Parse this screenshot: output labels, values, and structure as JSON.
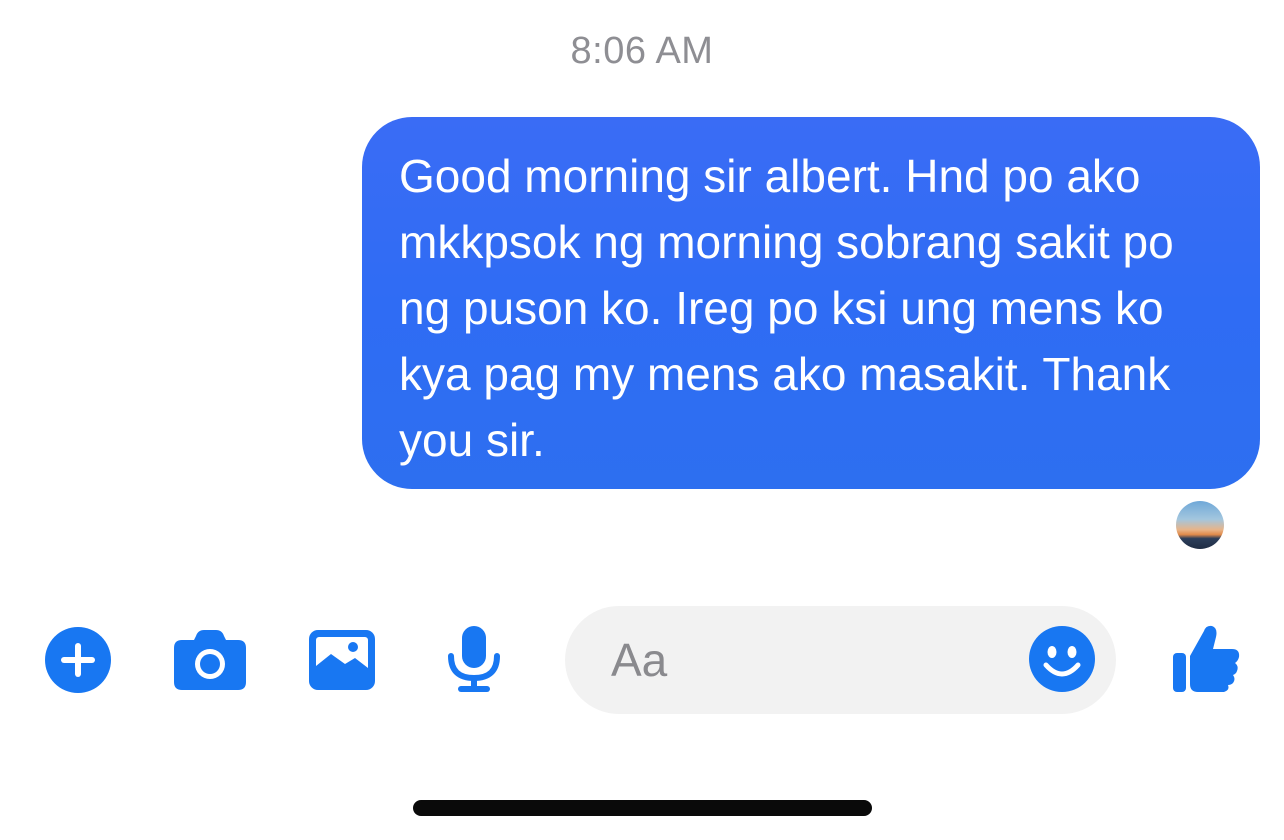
{
  "conversation": {
    "timestamp": "8:06 AM",
    "messages": [
      {
        "direction": "outgoing",
        "text": "Good morning sir albert. Hnd po ako mkkpsok ng morning sobrang sakit po ng puson ko. Ireg po ksi ung mens ko kya pag my mens ako masakit. Thank you sir."
      }
    ]
  },
  "composer": {
    "placeholder": "Aa",
    "value": "",
    "icons": [
      "plus-icon",
      "camera-icon",
      "gallery-icon",
      "microphone-icon",
      "emoji-icon",
      "thumbs-up-icon"
    ]
  },
  "colors": {
    "accent": "#1877f2",
    "bubble": "#2f6cf4",
    "input_bg": "#f2f2f2",
    "timestamp": "#8e8e93"
  }
}
